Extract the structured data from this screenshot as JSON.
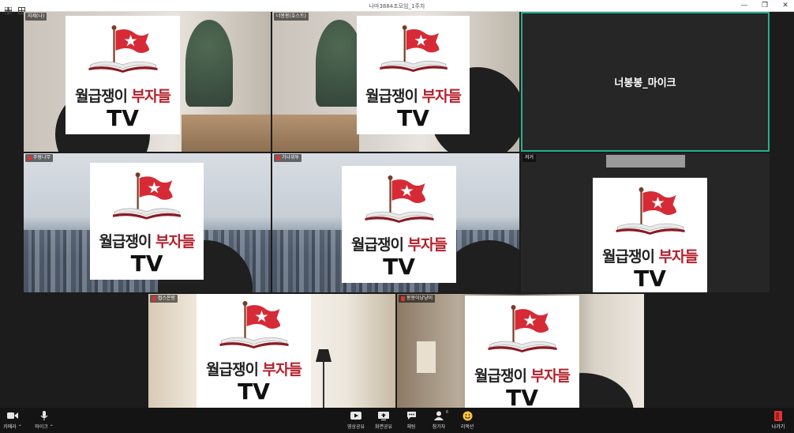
{
  "window": {
    "title": "나마3884조모임_1주차",
    "controls": [
      "minimize",
      "restore",
      "close"
    ]
  },
  "logo": {
    "line1_black": "월급쟁이 ",
    "line1_red": "부자들",
    "line2": "TV",
    "flag_color": "#d62b36",
    "book_color": "#8a1c24"
  },
  "tiles": [
    {
      "name": "지제(나)",
      "muted": false,
      "bg": "room"
    },
    {
      "name": "너봉봉(호스트)",
      "muted": false,
      "bg": "room"
    },
    {
      "name": "",
      "center_label": "너봉봉_마이크",
      "muted": false,
      "bg": "dark",
      "active_speaker": true
    },
    {
      "name": "주왕나무",
      "muted": true,
      "bg": "city"
    },
    {
      "name": "가나위투",
      "muted": true,
      "bg": "city"
    },
    {
      "name": "저거",
      "muted": false,
      "bg": "dark"
    },
    {
      "name": "접스온랑",
      "muted": true,
      "bg": "curtain"
    },
    {
      "name": "몽몽이냥냥이",
      "muted": true,
      "bg": "shop"
    }
  ],
  "toolbar": {
    "camera": "카메라",
    "mic": "마이크",
    "share_video": "영상공유",
    "share_screen": "화면공유",
    "chat": "채팅",
    "participants": "참가자",
    "participants_count": "8",
    "reactions": "리액션",
    "leave": "나가기"
  },
  "colors": {
    "active_border": "#27b08a",
    "leave": "#e0342f",
    "mute": "#d33333"
  }
}
